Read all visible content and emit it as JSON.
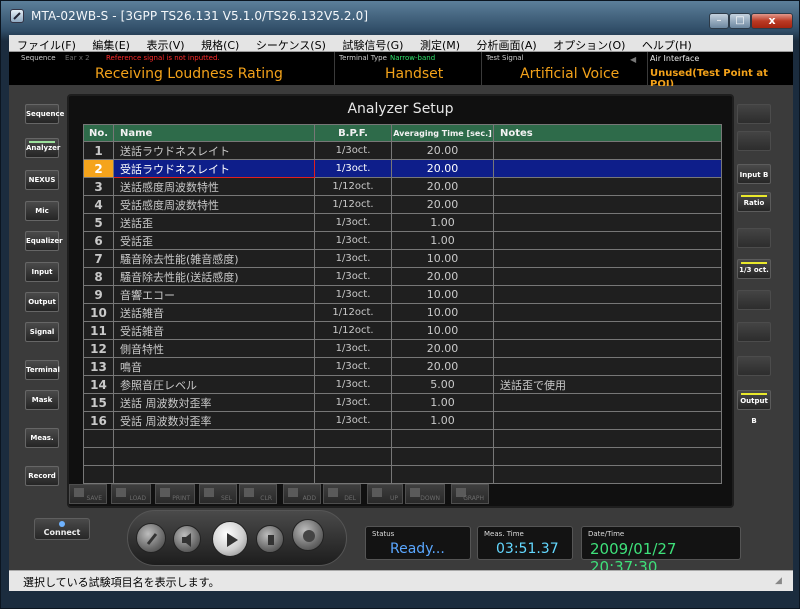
{
  "window": {
    "title": "MTA-02WB-S - [3GPP TS26.131 V5.1.0/TS26.132V5.2.0]",
    "buttons": {
      "minimize": "–",
      "maximize": "□",
      "close": "x"
    }
  },
  "menu": [
    "ファイル(F)",
    "編集(E)",
    "表示(V)",
    "規格(C)",
    "シーケンス(S)",
    "試験信号(G)",
    "測定(M)",
    "分析画面(A)",
    "オプション(O)",
    "ヘルプ(H)"
  ],
  "info": {
    "sequence_label": "Sequence",
    "ear_label": "Ear x 2",
    "warning": "Reference signal is not inputted.",
    "sequence_value": "Receiving Loudness Rating",
    "terminal_label": "Terminal Type",
    "terminal_band": "Narrow-band",
    "terminal_value": "Handset",
    "signal_label": "Test Signal",
    "signal_value": "Artificial Voice",
    "air_label": "Air Interface",
    "air_value": "Unused(Test Point at POI)"
  },
  "left_buttons": [
    "Sequence",
    "Analyzer",
    "NEXUS",
    "Mic",
    "Equalizer",
    "Input",
    "Output",
    "Signal",
    "Terminal",
    "Mask",
    "Meas.",
    "Record"
  ],
  "right_buttons": {
    "input_b": "Input B",
    "ratio": "Ratio",
    "octave": "1/3 oct.",
    "output_b": "Output B"
  },
  "panel": {
    "title": "Analyzer Setup",
    "columns": [
      "No.",
      "Name",
      "B.P.F.",
      "Averaging Time [sec.]",
      "Notes"
    ],
    "rows": [
      {
        "no": "1",
        "name": "送話ラウドネスレイト",
        "bpf": "1/3oct.",
        "avg": "20.00",
        "notes": ""
      },
      {
        "no": "2",
        "name": "受話ラウドネスレイト",
        "bpf": "1/3oct.",
        "avg": "20.00",
        "notes": ""
      },
      {
        "no": "3",
        "name": "送話感度周波数特性",
        "bpf": "1/12oct.",
        "avg": "20.00",
        "notes": ""
      },
      {
        "no": "4",
        "name": "受話感度周波数特性",
        "bpf": "1/12oct.",
        "avg": "20.00",
        "notes": ""
      },
      {
        "no": "5",
        "name": "送話歪",
        "bpf": "1/3oct.",
        "avg": "1.00",
        "notes": ""
      },
      {
        "no": "6",
        "name": "受話歪",
        "bpf": "1/3oct.",
        "avg": "1.00",
        "notes": ""
      },
      {
        "no": "7",
        "name": "騒音除去性能(雑音感度)",
        "bpf": "1/3oct.",
        "avg": "10.00",
        "notes": ""
      },
      {
        "no": "8",
        "name": "騒音除去性能(送話感度)",
        "bpf": "1/3oct.",
        "avg": "20.00",
        "notes": ""
      },
      {
        "no": "9",
        "name": "音響エコー",
        "bpf": "1/3oct.",
        "avg": "10.00",
        "notes": ""
      },
      {
        "no": "10",
        "name": "送話雑音",
        "bpf": "1/12oct.",
        "avg": "10.00",
        "notes": ""
      },
      {
        "no": "11",
        "name": "受話雑音",
        "bpf": "1/12oct.",
        "avg": "10.00",
        "notes": ""
      },
      {
        "no": "12",
        "name": "側音特性",
        "bpf": "1/3oct.",
        "avg": "20.00",
        "notes": ""
      },
      {
        "no": "13",
        "name": "鳴音",
        "bpf": "1/3oct.",
        "avg": "20.00",
        "notes": ""
      },
      {
        "no": "14",
        "name": "参照音圧レベル",
        "bpf": "1/3oct.",
        "avg": "5.00",
        "notes": "送話歪で使用"
      },
      {
        "no": "15",
        "name": "送話 周波数対歪率",
        "bpf": "1/3oct.",
        "avg": "1.00",
        "notes": ""
      },
      {
        "no": "16",
        "name": "受話 周波数対歪率",
        "bpf": "1/3oct.",
        "avg": "1.00",
        "notes": ""
      }
    ],
    "selected_row": "2"
  },
  "toolbar": [
    "SAVE",
    "LOAD",
    "PRINT",
    "SEL",
    "CLR",
    "ADD",
    "DEL",
    "UP",
    "DOWN",
    "GRAPH"
  ],
  "connect_label": "Connect",
  "status": {
    "label": "Status",
    "value": "Ready..."
  },
  "meas_time": {
    "label": "Meas. Time",
    "value": "03:51.37"
  },
  "datetime": {
    "label": "Date/Time",
    "value": "2009/01/27 20:37:30"
  },
  "statusbar": "選択している試験項目名を表示します。",
  "colors": {
    "accent_orange": "#f3a21a",
    "selected_row": "#0e1e8a",
    "header_green": "#2e6b4a",
    "status_blue": "#5aa7ff",
    "date_green": "#3ee07a"
  }
}
